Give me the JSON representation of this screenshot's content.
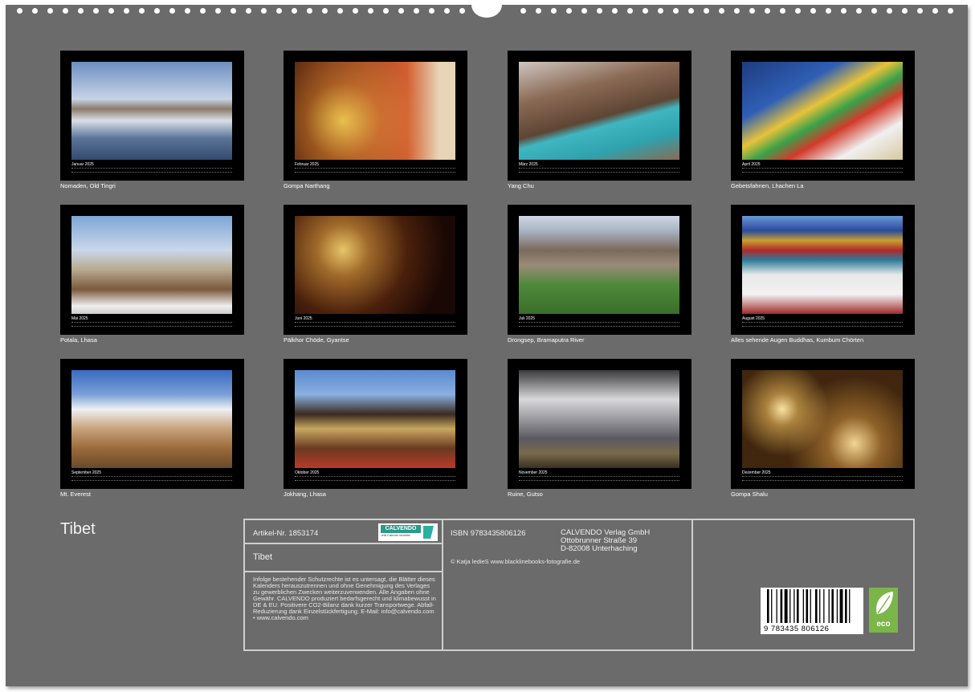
{
  "months": [
    {
      "month": "Januar",
      "year": "2025",
      "caption": "Nomaden, Old Tingri"
    },
    {
      "month": "Februar",
      "year": "2025",
      "caption": "Gompa Narthang"
    },
    {
      "month": "März",
      "year": "2025",
      "caption": "Yang Chu"
    },
    {
      "month": "April",
      "year": "2025",
      "caption": "Gebetsfahnen, Lhachen La"
    },
    {
      "month": "Mai",
      "year": "2025",
      "caption": "Potala, Lhasa"
    },
    {
      "month": "Juni",
      "year": "2025",
      "caption": "Pälkhor Chöde, Gyantse"
    },
    {
      "month": "Juli",
      "year": "2025",
      "caption": "Drongsep, Bramaputra River"
    },
    {
      "month": "August",
      "year": "2025",
      "caption": "Alles sehende Augen Buddhas, Kumbum Chörten"
    },
    {
      "month": "September",
      "year": "2025",
      "caption": "Mt. Everest"
    },
    {
      "month": "Oktober",
      "year": "2025",
      "caption": "Jokhang, Lhasa"
    },
    {
      "month": "November",
      "year": "2025",
      "caption": "Ruine, Gutso"
    },
    {
      "month": "Dezember",
      "year": "2025",
      "caption": "Gompa Shalu"
    }
  ],
  "title": "Tibet",
  "info": {
    "article": "Artikel-Nr. 1853174",
    "logo_text": "CALVENDO",
    "logo_sub": "Jetzt Kalender bestellen",
    "product_title": "Tibet",
    "legal": "Infolge bestehender Schutzrechte ist es untersagt, die Blätter dieses Kalenders herauszutrennen und ohne Genehmigung des Verlages zu gewerblichen Zwecken weiterzuverwenden. Alle Angaben ohne Gewähr. CALVENDO produziert bedarfsgerecht und klimabewusst in DE & EU. Positivere CO2-Bilanz dank kurzer Transportwege. Abfall-Reduzierung dank Einzelstückfertigung. E-Mail: info@calvendo.com • www.calvendo.com",
    "isbn": "ISBN 9783435806126",
    "publisher_name": "CALVENDO Verlag GmbH",
    "publisher_street": "Ottobrunner Straße 39",
    "publisher_city": "D-82008 Unterhaching",
    "copyright": "© Katja ledieS www.blacklinebooks-fotografie.de",
    "barcode_digits": "9 783435 806126",
    "eco_label": "eco"
  },
  "colors": {
    "background": "#6b6b6b",
    "frame": "#000000",
    "text": "#ffffff",
    "eco": "#7ab648"
  }
}
